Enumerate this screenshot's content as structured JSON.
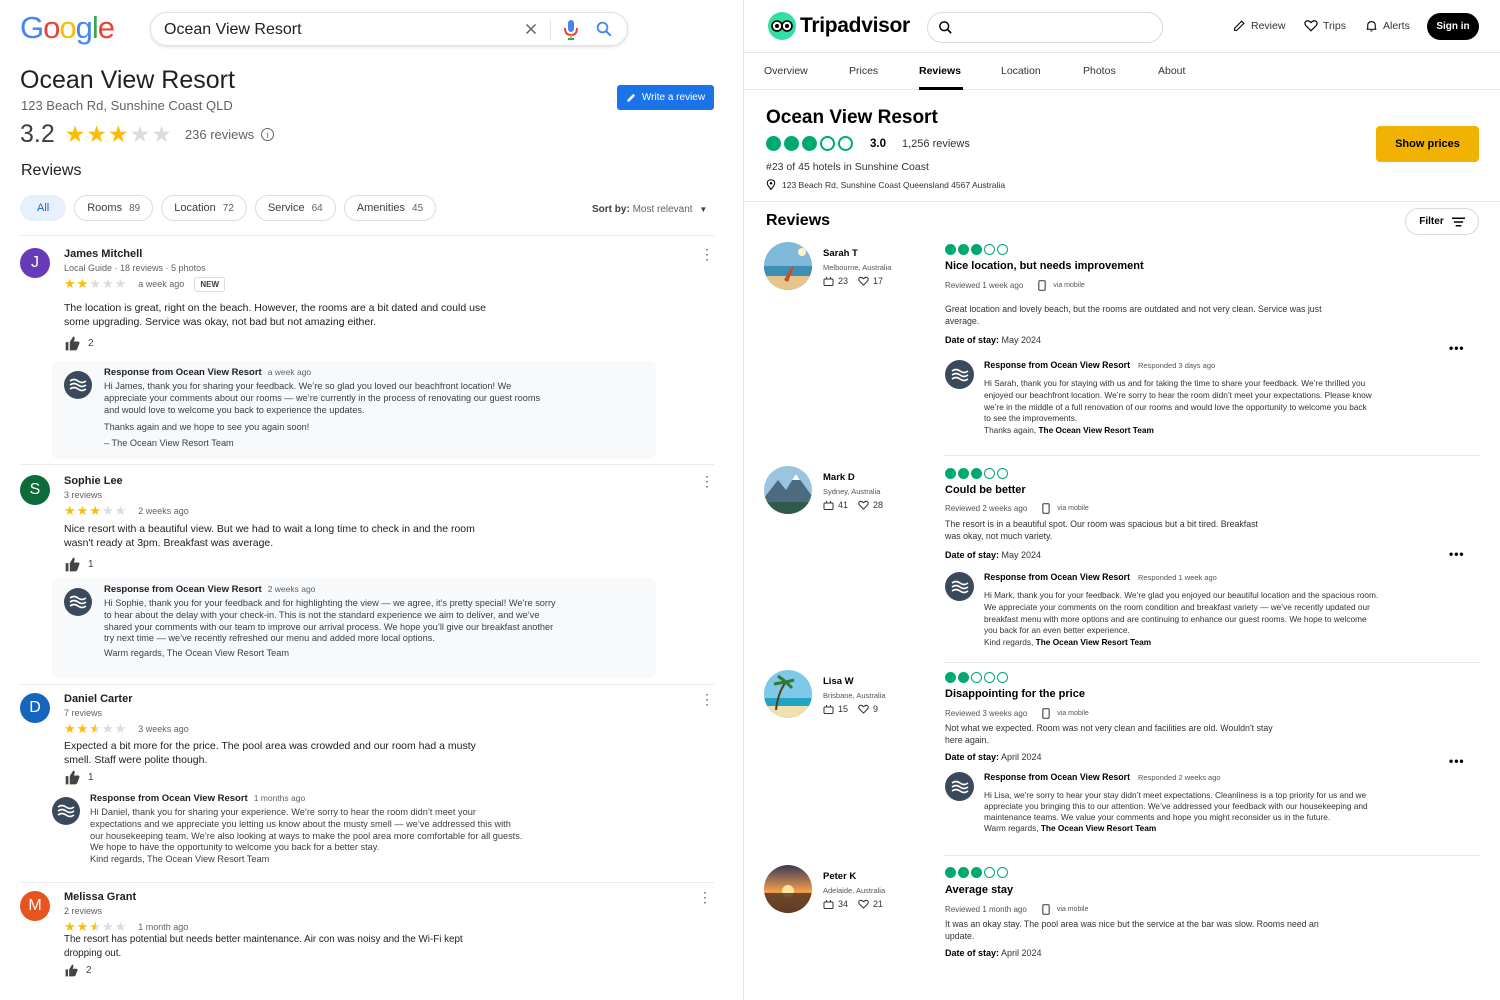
{
  "google": {
    "logo": [
      "G",
      "o",
      "o",
      "g",
      "l",
      "e"
    ],
    "search": {
      "value": "Ocean View Resort"
    },
    "title": "Ocean View Resort",
    "address": "123 Beach Rd, Sunshine Coast QLD",
    "write_review": "Write a review",
    "rating": {
      "value": "3.2",
      "stars": 3,
      "count": "236 reviews"
    },
    "reviews_heading": "Reviews",
    "chips": [
      {
        "label": "All",
        "count": ""
      },
      {
        "label": "Rooms",
        "count": "89"
      },
      {
        "label": "Location",
        "count": "72"
      },
      {
        "label": "Service",
        "count": "64"
      },
      {
        "label": "Amenities",
        "count": "45"
      }
    ],
    "sort": {
      "label": "Sort by:",
      "value": "Most relevant"
    },
    "reviews": [
      {
        "initial": "J",
        "color": "#673ab7",
        "name": "James Mitchell",
        "meta": "Local Guide · 18 reviews · 5 photos",
        "stars": 2,
        "time": "a week ago",
        "badge": "NEW",
        "text": "The location is great, right on the beach. However, the rooms are a bit dated and could use some upgrading. Service was okay, not bad but not amazing either.",
        "likes": "2",
        "response": {
          "from": "Response from Ocean View Resort",
          "time": "a week ago",
          "p1": "Hi James, thank you for sharing your feedback. We’re so glad you loved our beachfront location! We appreciate your comments about our rooms — we’re currently in the process of renovating our guest rooms and would love to welcome you back to experience the updates.",
          "p2": "Thanks again and we hope to see you again soon!",
          "p3": "– The Ocean View Resort Team"
        }
      },
      {
        "initial": "S",
        "color": "#0b6b3a",
        "name": "Sophie Lee",
        "meta": "3 reviews",
        "stars": 3,
        "time": "2 weeks ago",
        "badge": "",
        "text": "Nice resort with a beautiful view. But we had to wait a long time to check in and the room wasn't ready at 3pm. Breakfast was average.",
        "likes": "1",
        "response": {
          "from": "Response from Ocean View Resort",
          "time": "2 weeks ago",
          "p1": "Hi Sophie, thank you for your feedback and for highlighting the view — we agree, it’s pretty special! We’re sorry to hear about the delay with your check-in. This is not the standard experience we aim to deliver, and we’ve shared your comments with our team to improve our arrival process. We hope you’ll give our breakfast another try next time — we’ve recently refreshed our menu and added more local options.",
          "p2": "Warm regards, The Ocean View Resort Team",
          "p3": ""
        }
      },
      {
        "initial": "D",
        "color": "#1565c0",
        "name": "Daniel Carter",
        "meta": "7 reviews",
        "stars": 2.5,
        "time": "3 weeks ago",
        "badge": "",
        "text": "Expected a bit more for the price. The pool area was crowded and our room had a musty smell. Staff were polite though.",
        "likes": "1",
        "response": {
          "from": "Response from Ocean View Resort",
          "time": "1 months ago",
          "p1": "Hi Daniel, thank you for sharing your experience. We’re sorry to hear the room didn’t meet your expectations and we appreciate you letting us know about the musty smell — we’ve addressed this with our housekeeping team. We’re also looking at ways to make the pool area more comfortable for all guests. We hope to have the opportunity to welcome you back for a better stay.",
          "p2": "Kind regards, The Ocean View Resort Team",
          "p3": ""
        }
      },
      {
        "initial": "M",
        "color": "#e8541e",
        "name": "Melissa Grant",
        "meta": "2 reviews",
        "stars": 2.5,
        "time": "1 month ago",
        "badge": "",
        "text": "The resort has potential but needs better maintenance. Air con was noisy and the Wi-Fi kept dropping out.",
        "likes": "2"
      }
    ]
  },
  "trip": {
    "logo": "Tripadvisor",
    "nav": {
      "review": "Review",
      "trips": "Trips",
      "alerts": "Alerts",
      "signin": "Sign in"
    },
    "tabs": [
      "Overview",
      "Prices",
      "Reviews",
      "Location",
      "Photos",
      "About"
    ],
    "title": "Ocean View Resort",
    "rating": {
      "value": "3.0",
      "bubbles": 3,
      "count": "1,256 reviews"
    },
    "rank": "#23 of 45 hotels in Sunshine Coast",
    "address": "123 Beach Rd, Sunshine Coast Queensland 4567 Australia",
    "show_prices": "Show prices",
    "reviews_heading": "Reviews",
    "filter": "Filter",
    "reviews": [
      {
        "name": "Sarah T",
        "location": "Melbourne, Australia",
        "contributions": "23",
        "helpful": "17",
        "bubbles": 3,
        "title": "Nice location, but needs improvement",
        "reviewed": "Reviewed 1 week ago",
        "via": "via mobile",
        "text": "Great location and lovely beach, but the rooms are outdated and not very clean. Service was just average.",
        "stay_label": "Date of stay:",
        "stay": "May 2024",
        "response": {
          "from": "Response from Ocean View Resort",
          "time": "Responded 3 days ago",
          "body": "Hi Sarah, thank you for staying with us and for taking the time to share your feedback. We’re thrilled you enjoyed our beachfront location. We’re sorry to hear the room didn’t meet your expectations. Please know we’re in the middle of a full renovation of our rooms and would love the opportunity to welcome you back to see the improvements.",
          "closing": "Thanks again, ",
          "team": "The Ocean View Resort Team"
        }
      },
      {
        "name": "Mark D",
        "location": "Sydney, Australia",
        "contributions": "41",
        "helpful": "28",
        "bubbles": 3,
        "title": "Could be better",
        "reviewed": "Reviewed 2 weeks ago",
        "via": "via mobile",
        "text": "The resort is in a beautiful spot. Our room was spacious but a bit tired. Breakfast was okay, not much variety.",
        "stay_label": "Date of stay:",
        "stay": "May 2024",
        "response": {
          "from": "Response from Ocean View Resort",
          "time": "Responded 1 week ago",
          "body": "Hi Mark, thank you for your feedback. We’re glad you enjoyed our beautiful location and the spacious room. We appreciate your comments on the room condition and breakfast variety — we’ve recently updated our breakfast menu with more options and are continuing to enhance our guest rooms. We hope to welcome you back for an even better experience.",
          "closing": "Kind regards, ",
          "team": "The Ocean View Resort Team"
        }
      },
      {
        "name": "Lisa W",
        "location": "Brisbane, Australia",
        "contributions": "15",
        "helpful": "9",
        "bubbles": 2,
        "title": "Disappointing for the price",
        "reviewed": "Reviewed 3 weeks ago",
        "via": "via mobile",
        "text": "Not what we expected. Room was not very clean and facilities are old. Wouldn't stay here again.",
        "stay_label": "Date of stay:",
        "stay": "April 2024",
        "response": {
          "from": "Response from Ocean View Resort",
          "time": "Responded 2 weeks ago",
          "body": "Hi Lisa, we’re sorry to hear your stay didn’t meet expectations. Cleanliness is a top priority for us and we appreciate you bringing this to our attention. We’ve addressed your feedback with our housekeeping and maintenance teams. We value your comments and hope you might reconsider us in the future.",
          "closing": "Warm regards, ",
          "team": "The Ocean View Resort Team"
        }
      },
      {
        "name": "Peter K",
        "location": "Adelaide, Australia",
        "contributions": "34",
        "helpful": "21",
        "bubbles": 3,
        "title": "Average stay",
        "reviewed": "Reviewed 1 month ago",
        "via": "via mobile",
        "text": "It was an okay stay. The pool area was nice but the service at the bar was slow. Rooms need an update.",
        "stay_label": "Date of stay:",
        "stay": "April 2024"
      }
    ]
  }
}
